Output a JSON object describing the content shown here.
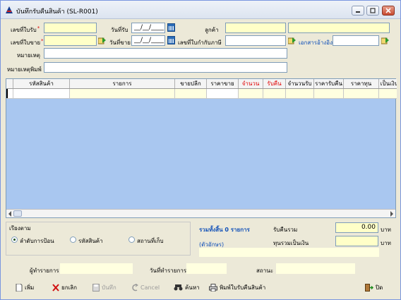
{
  "window": {
    "title": "บันทึกรับคืนสินค้า (SL-R001)"
  },
  "header": {
    "receipt_no_label": "เลขที่ใบรับ",
    "receipt_date_label": "วันที่รับ",
    "receipt_date_value": "__/__/____",
    "customer_label": "ลูกค้า",
    "sale_no_label": "เลขที่ใบขาย",
    "sale_date_label": "วันที่ขาย",
    "sale_date_value": "__/__/____",
    "tax_invoice_label": "เลขที่ใบกำกับภาษี",
    "ref_doc_label": "เอกสารอ้างอิง",
    "note_label": "หมายเหตุ",
    "print_note_label": "หมายเหตุพิมพ์"
  },
  "grid": {
    "columns": [
      "",
      "รหัสสินค้า",
      "รายการ",
      "ขายปลีก",
      "ราคาขาย",
      "จำนวน",
      "รับคืน",
      "จำนวนรับ",
      "ราคารับคืน",
      "ราคาทุน",
      "เป็นเงิน"
    ],
    "red_columns": [
      "จำนวน",
      "รับคืน"
    ]
  },
  "sort": {
    "title": "เรียงตาม",
    "options": [
      "ลำดับการป้อน",
      "รหัสสินค้า",
      "สถานที่เก็บ"
    ],
    "selected": "ลำดับการป้อน"
  },
  "summary": {
    "total_items_text": "รวมทั้งสิ้น 0 รายการ",
    "amount_words_label": "(ตัวอักษร)",
    "return_total_label": "รับคืนรวม",
    "return_total_value": "0.00",
    "currency_unit": "บาท",
    "cost_total_label": "ทุนรวมเป็นเงิน",
    "cost_total_value": "",
    "currency_unit_2": "บาท"
  },
  "footer": {
    "operator_label": "ผู้ทำรายการ",
    "operation_date_label": "วันที่ทำรายการ",
    "status_label": "สถานะ"
  },
  "toolbar": {
    "add": "เพิ่ม",
    "cancel_edit": "ยกเลิก",
    "save": "บันทึก",
    "cancel": "Cancel",
    "search": "ค้นหา",
    "print": "พิมพ์ใบรับคืนสินค้า",
    "close": "ปิด"
  },
  "colors": {
    "grid_bg": "#a9c7f0",
    "field_bg": "#ffffc8",
    "accent_blue": "#0f4fb8",
    "required_red": "#e00000"
  }
}
